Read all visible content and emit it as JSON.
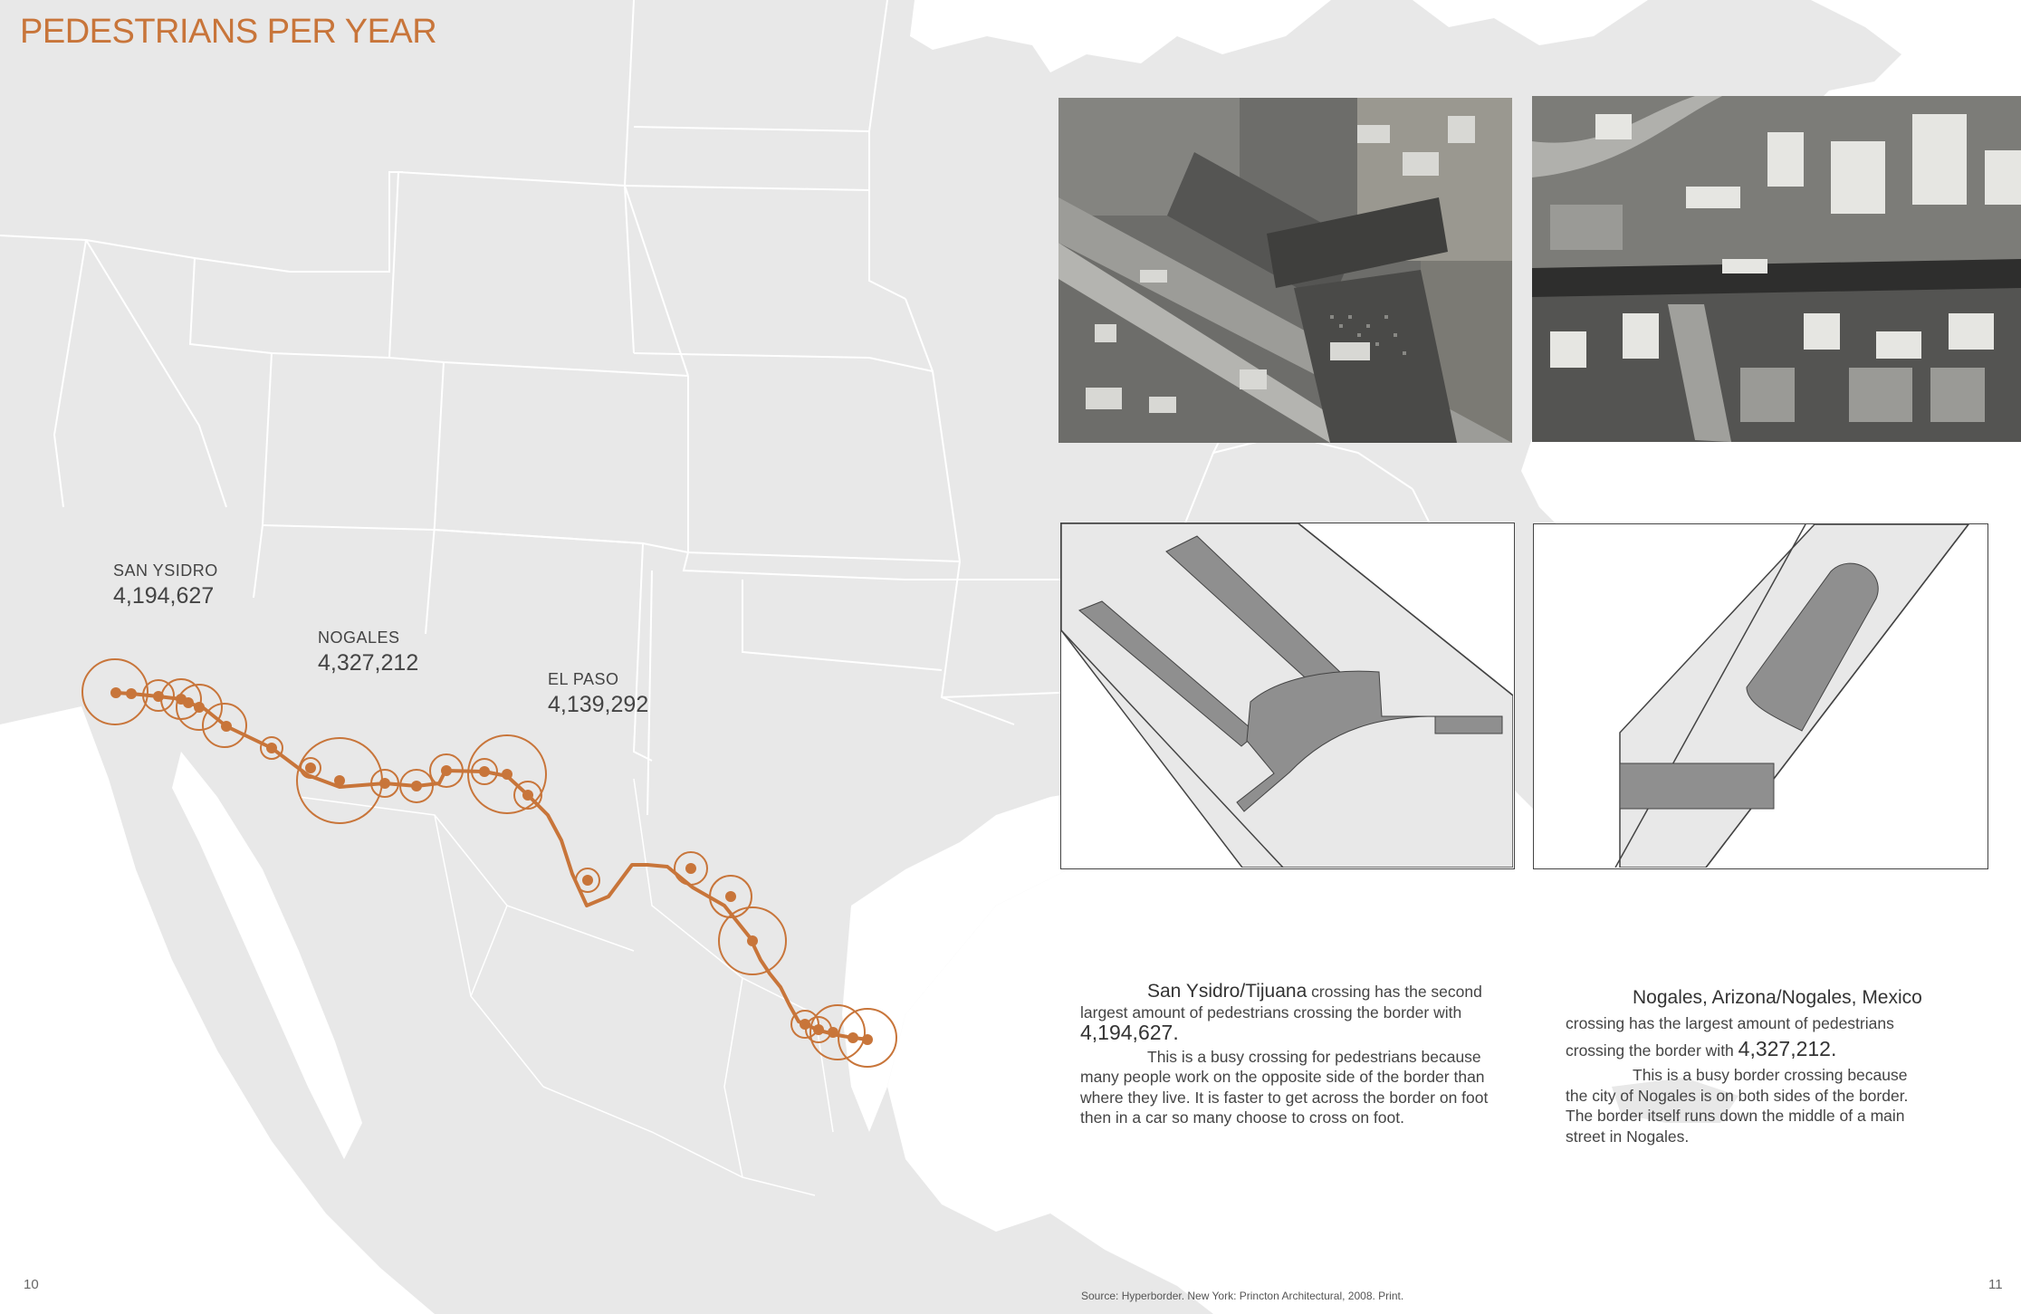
{
  "page": {
    "title": "PEDESTRIANS PER YEAR",
    "page_left": "10",
    "page_right": "11",
    "source": "Source: Hyperborder. New York: Princton Architectural, 2008. Print."
  },
  "map_labels": [
    {
      "name": "SAN YSIDRO",
      "value": "4,194,627"
    },
    {
      "name": "NOGALES",
      "value": "4,327,212"
    },
    {
      "name": "EL PASO",
      "value": "4,139,292"
    }
  ],
  "colors": {
    "accent": "#c8753a",
    "land": "#e8e8e8",
    "plan_light": "#e8e8e8",
    "plan_dark": "#8f8f8f"
  },
  "images": {
    "photo_left": "aerial photo of San Ysidro/Tijuana border crossing",
    "photo_right": "aerial photo of Nogales border crossing",
    "plan_left": "site plan diagram San Ysidro",
    "plan_right": "site plan diagram Nogales"
  },
  "text_blocks": {
    "san_ysidro": {
      "lead": "San Ysidro/Tijuana",
      "p1_rest": " crossing has the second largest amount of pedestrians crossing the border with ",
      "number": "4,194,627.",
      "p2": "This is a busy crossing for pedestrians because many people work on the opposite side of the border than where they live.  It is faster to get across the border on foot then in a car so many choose to cross on foot."
    },
    "nogales": {
      "lead": "Nogales, Arizona/Nogales, Mexico",
      "p1_rest": " crossing has the largest amount of pedestrians crossing the border with ",
      "number": "4,327,212.",
      "p2": "This is a busy border crossing because the city of Nogales is on both sides of the border. The border itself runs down the middle of a main street in Nogales."
    }
  }
}
